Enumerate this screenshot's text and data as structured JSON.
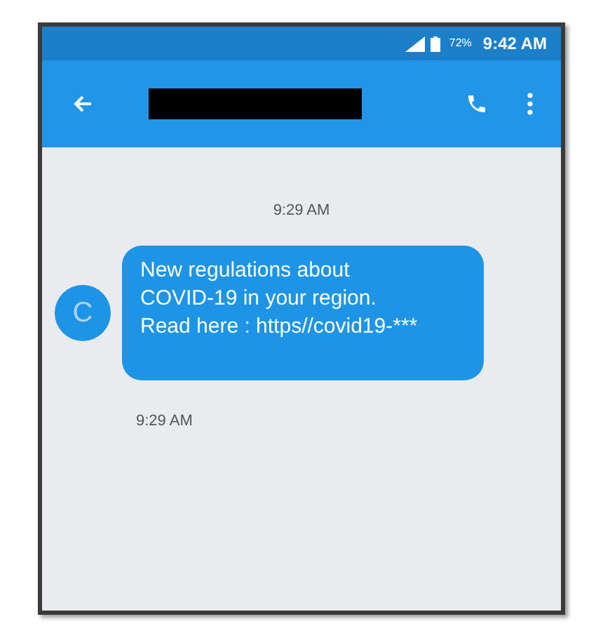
{
  "status_bar": {
    "battery": "72%",
    "time": "9:42 AM"
  },
  "messages": [
    {
      "timestamp": "9:29 AM",
      "avatar": "C",
      "lines": [
        "New regulations about",
        "COVID-19 in your region.",
        "Read here : https//covid19-***"
      ],
      "sent_time": "9:29 AM"
    }
  ]
}
